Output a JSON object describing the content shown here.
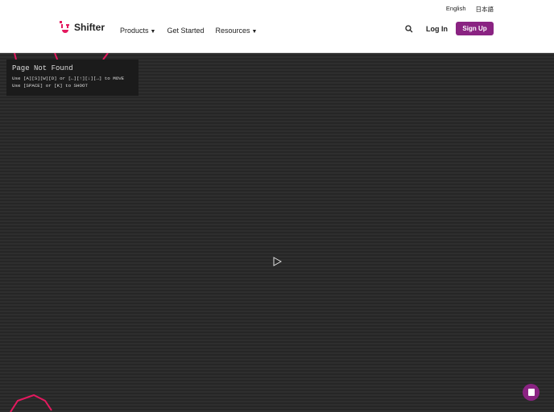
{
  "header": {
    "brand": "Shifter",
    "nav": [
      {
        "label": "Products",
        "caret": true
      },
      {
        "label": "Get Started",
        "caret": false
      },
      {
        "label": "Resources",
        "caret": true
      }
    ],
    "languages": [
      "English",
      "日本語"
    ],
    "login_label": "Log In",
    "signup_label": "Sign Up"
  },
  "game": {
    "title": "Page Not Found",
    "instructions": [
      "Use [A][S][W][D] or [←][↑][↓][→] to MOVE",
      "Use [SPACE] or [K] to SHOOT"
    ]
  },
  "colors": {
    "brand": "#e4195f",
    "accent": "#8a2382",
    "background": "#2b2b2b"
  }
}
